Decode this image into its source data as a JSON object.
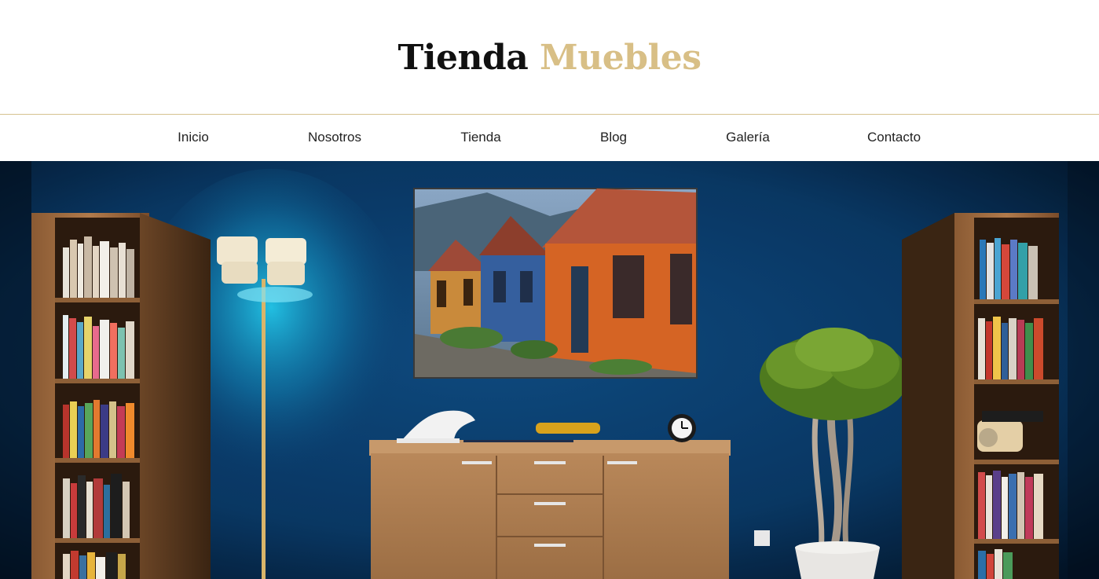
{
  "site": {
    "logo_first": "Tienda",
    "logo_second": "Muebles",
    "accent_color": "#d8bf86"
  },
  "nav": {
    "items": [
      {
        "label": "Inicio"
      },
      {
        "label": "Nosotros"
      },
      {
        "label": "Tienda"
      },
      {
        "label": "Blog"
      },
      {
        "label": "Galería"
      },
      {
        "label": "Contacto"
      }
    ]
  },
  "hero": {
    "image": "living-room-blue-wall"
  }
}
